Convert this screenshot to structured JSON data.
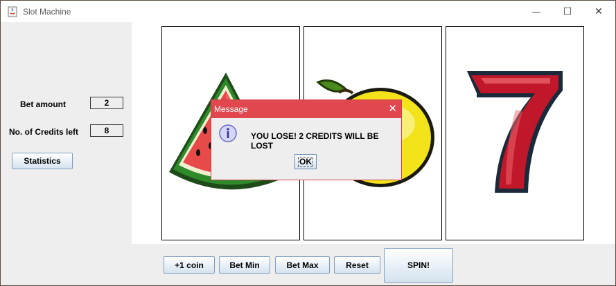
{
  "window": {
    "title": "Slot Machine",
    "minimize_glyph": "—",
    "maximize_glyph": "☐",
    "close_glyph": "✕"
  },
  "left_panel": {
    "bet_label": "Bet amount",
    "bet_value": "2",
    "credits_label": "No. of Credits left",
    "credits_value": "8",
    "statistics_button": "Statistics"
  },
  "reels": [
    {
      "symbol": "watermelon-icon"
    },
    {
      "symbol": "lemon-icon"
    },
    {
      "symbol": "seven-icon"
    }
  ],
  "controls": {
    "add_coin": "+1 coin",
    "bet_min": "Bet Min",
    "bet_max": "Bet Max",
    "reset": "Reset",
    "spin": "SPIN!"
  },
  "dialog": {
    "title": "Message",
    "close_glyph": "✕",
    "icon": "info-icon",
    "message": "YOU LOSE! 2 CREDITS WILL BE LOST",
    "ok_label": "OK"
  },
  "colors": {
    "dialog_titlebar": "#e0474f",
    "button_border": "#7a9ebf",
    "seven_red": "#c0182a"
  }
}
